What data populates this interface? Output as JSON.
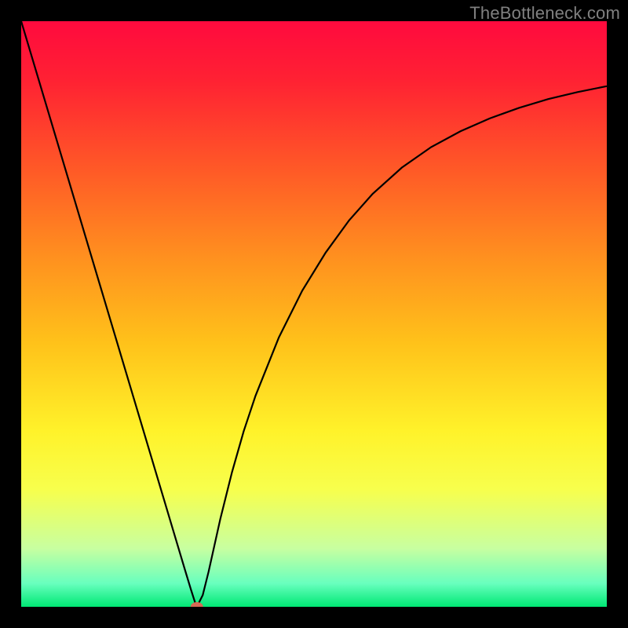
{
  "attribution": "TheBottleneck.com",
  "chart_data": {
    "type": "line",
    "title": "",
    "xlabel": "",
    "ylabel": "",
    "xlim": [
      0,
      100
    ],
    "ylim": [
      0,
      100
    ],
    "background_gradient": {
      "stops": [
        {
          "offset": 0.0,
          "color": "#ff0a3e"
        },
        {
          "offset": 0.1,
          "color": "#ff2133"
        },
        {
          "offset": 0.25,
          "color": "#ff5827"
        },
        {
          "offset": 0.4,
          "color": "#ff8f1f"
        },
        {
          "offset": 0.55,
          "color": "#ffc21a"
        },
        {
          "offset": 0.7,
          "color": "#fff22a"
        },
        {
          "offset": 0.8,
          "color": "#f7ff4d"
        },
        {
          "offset": 0.9,
          "color": "#c8ffa0"
        },
        {
          "offset": 0.96,
          "color": "#68ffbe"
        },
        {
          "offset": 1.0,
          "color": "#00e874"
        }
      ]
    },
    "series": [
      {
        "name": "bottleneck-curve",
        "color": "#000000",
        "x": [
          0.0,
          2.0,
          4.0,
          6.0,
          8.0,
          10.0,
          12.0,
          14.0,
          16.0,
          18.0,
          20.0,
          22.0,
          24.0,
          26.0,
          28.0,
          29.0,
          29.8,
          30.2,
          31.0,
          32.0,
          34.0,
          36.0,
          38.0,
          40.0,
          44.0,
          48.0,
          52.0,
          56.0,
          60.0,
          65.0,
          70.0,
          75.0,
          80.0,
          85.0,
          90.0,
          95.0,
          100.0
        ],
        "y": [
          100.0,
          93.3,
          86.6,
          79.9,
          73.2,
          66.5,
          59.8,
          53.1,
          46.4,
          39.7,
          33.0,
          26.3,
          19.6,
          12.9,
          6.2,
          2.9,
          0.4,
          0.4,
          2.0,
          6.0,
          15.0,
          23.0,
          30.0,
          36.0,
          46.0,
          54.0,
          60.5,
          66.0,
          70.5,
          75.0,
          78.5,
          81.2,
          83.4,
          85.2,
          86.7,
          87.9,
          88.9
        ]
      }
    ],
    "marker": {
      "name": "optimal-point",
      "x": 30.0,
      "y": 0.0,
      "color": "#d66a55",
      "rx": 8,
      "ry": 6
    }
  }
}
